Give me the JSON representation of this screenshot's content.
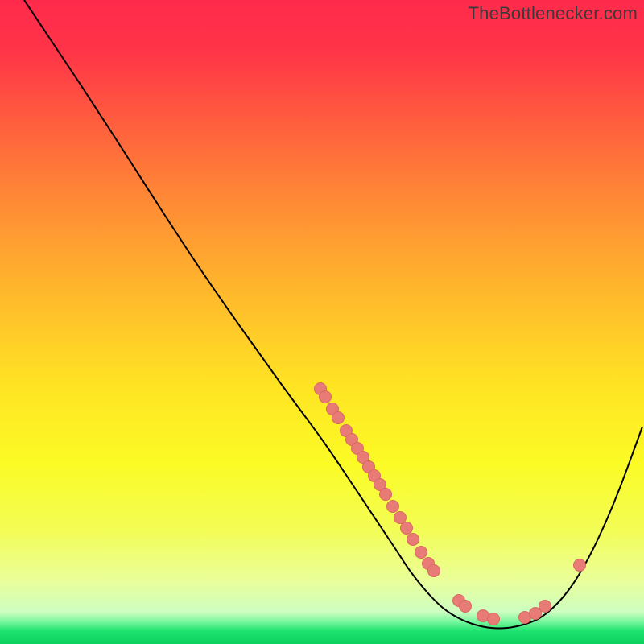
{
  "watermark": "TheBottlenecker.com",
  "chart_data": {
    "type": "line",
    "title": "",
    "xlabel": "",
    "ylabel": "",
    "xlim": [
      30,
      800
    ],
    "ylim": [
      800,
      0
    ],
    "background_gradient": {
      "stops": [
        {
          "offset": 0.0,
          "color": "#ff2a4b"
        },
        {
          "offset": 0.08,
          "color": "#ff3448"
        },
        {
          "offset": 0.18,
          "color": "#ff5a3f"
        },
        {
          "offset": 0.3,
          "color": "#ff8636"
        },
        {
          "offset": 0.45,
          "color": "#ffb72c"
        },
        {
          "offset": 0.6,
          "color": "#ffe423"
        },
        {
          "offset": 0.72,
          "color": "#fbfb25"
        },
        {
          "offset": 0.82,
          "color": "#f3fd53"
        },
        {
          "offset": 0.9,
          "color": "#eafe98"
        },
        {
          "offset": 0.95,
          "color": "#cefec1"
        },
        {
          "offset": 0.965,
          "color": "#7af79f"
        },
        {
          "offset": 0.98,
          "color": "#1de26e"
        },
        {
          "offset": 1.0,
          "color": "#0cd25f"
        }
      ]
    },
    "series": [
      {
        "name": "bottleneck-curve",
        "color": "#000000",
        "width": 2,
        "path": [
          {
            "x": 30,
            "y": 0
          },
          {
            "x": 60,
            "y": 45
          },
          {
            "x": 100,
            "y": 105
          },
          {
            "x": 150,
            "y": 182
          },
          {
            "x": 200,
            "y": 260
          },
          {
            "x": 250,
            "y": 336
          },
          {
            "x": 300,
            "y": 408
          },
          {
            "x": 350,
            "y": 478
          },
          {
            "x": 400,
            "y": 546
          },
          {
            "x": 430,
            "y": 590
          },
          {
            "x": 460,
            "y": 635
          },
          {
            "x": 490,
            "y": 680
          },
          {
            "x": 510,
            "y": 710
          },
          {
            "x": 530,
            "y": 735
          },
          {
            "x": 550,
            "y": 755
          },
          {
            "x": 570,
            "y": 768
          },
          {
            "x": 590,
            "y": 776
          },
          {
            "x": 610,
            "y": 780
          },
          {
            "x": 630,
            "y": 780
          },
          {
            "x": 650,
            "y": 776
          },
          {
            "x": 670,
            "y": 768
          },
          {
            "x": 690,
            "y": 752
          },
          {
            "x": 710,
            "y": 728
          },
          {
            "x": 730,
            "y": 695
          },
          {
            "x": 750,
            "y": 654
          },
          {
            "x": 770,
            "y": 606
          },
          {
            "x": 790,
            "y": 552
          },
          {
            "x": 798,
            "y": 530
          }
        ]
      }
    ],
    "points": {
      "name": "scatter-dots",
      "fill": "#e97b77",
      "stroke": "#d86863",
      "radius": 7.5,
      "data": [
        {
          "x": 398,
          "y": 483
        },
        {
          "x": 404,
          "y": 493
        },
        {
          "x": 413,
          "y": 508
        },
        {
          "x": 420,
          "y": 519
        },
        {
          "x": 430,
          "y": 535
        },
        {
          "x": 437,
          "y": 546
        },
        {
          "x": 444,
          "y": 557
        },
        {
          "x": 451,
          "y": 568
        },
        {
          "x": 458,
          "y": 580
        },
        {
          "x": 465,
          "y": 591
        },
        {
          "x": 472,
          "y": 602
        },
        {
          "x": 479,
          "y": 614
        },
        {
          "x": 488,
          "y": 629
        },
        {
          "x": 497,
          "y": 643
        },
        {
          "x": 505,
          "y": 656
        },
        {
          "x": 513,
          "y": 670
        },
        {
          "x": 523,
          "y": 686
        },
        {
          "x": 532,
          "y": 700
        },
        {
          "x": 539,
          "y": 709
        },
        {
          "x": 570,
          "y": 746
        },
        {
          "x": 578,
          "y": 753
        },
        {
          "x": 600,
          "y": 765
        },
        {
          "x": 613,
          "y": 769
        },
        {
          "x": 652,
          "y": 767
        },
        {
          "x": 665,
          "y": 762
        },
        {
          "x": 677,
          "y": 753
        },
        {
          "x": 720,
          "y": 702
        }
      ]
    }
  }
}
